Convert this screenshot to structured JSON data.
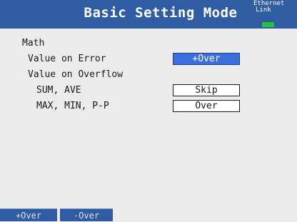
{
  "header": {
    "title": "Basic Setting Mode",
    "ethernet_label_line1": "Ethernet",
    "ethernet_label_line2": "Link"
  },
  "section": {
    "label": "Math"
  },
  "rows": {
    "value_on_error": {
      "label": "Value on Error",
      "value": "+Over"
    },
    "value_on_overflow": {
      "label": "Value on Overflow"
    },
    "sum_ave": {
      "label": "SUM, AVE",
      "value": "Skip"
    },
    "max_min_pp": {
      "label": "MAX, MIN, P-P",
      "value": "Over"
    }
  },
  "softkeys": {
    "key1": "+Over",
    "key2": "-Over"
  },
  "colors": {
    "header_bg": "#2f5ca3",
    "selected_field": "#3a6fdc",
    "link_indicator": "#22c33a",
    "background": "#ececec"
  }
}
